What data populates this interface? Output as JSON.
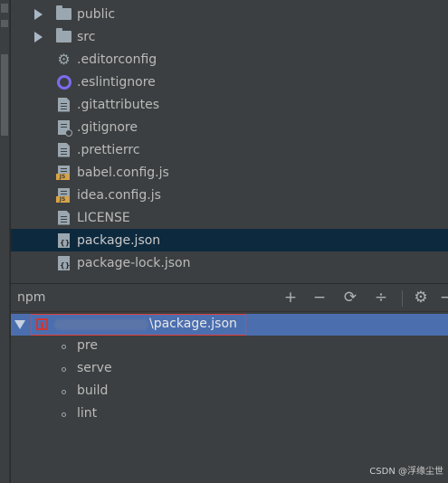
{
  "project_tree": {
    "items": [
      {
        "label": "public",
        "kind": "folder",
        "icon": "folder-icon",
        "expandable": true
      },
      {
        "label": "src",
        "kind": "folder",
        "icon": "folder-icon",
        "expandable": true
      },
      {
        "label": ".editorconfig",
        "kind": "config",
        "icon": "gear-icon"
      },
      {
        "label": ".eslintignore",
        "kind": "eslint",
        "icon": "eslint-icon"
      },
      {
        "label": ".gitattributes",
        "kind": "text",
        "icon": "text-file-icon"
      },
      {
        "label": ".gitignore",
        "kind": "ignore",
        "icon": "ignore-file-icon"
      },
      {
        "label": ".prettierrc",
        "kind": "text",
        "icon": "text-file-icon"
      },
      {
        "label": "babel.config.js",
        "kind": "js",
        "icon": "js-file-icon"
      },
      {
        "label": "idea.config.js",
        "kind": "js",
        "icon": "js-file-icon"
      },
      {
        "label": "LICENSE",
        "kind": "text",
        "icon": "text-file-icon"
      },
      {
        "label": "package.json",
        "kind": "json",
        "icon": "json-file-icon",
        "selected": true
      },
      {
        "label": "package-lock.json",
        "kind": "json",
        "icon": "json-file-icon"
      }
    ]
  },
  "npm_panel": {
    "title": "npm",
    "toolbar": {
      "add_icon": "+",
      "remove_icon": "−",
      "refresh_icon": "⟳",
      "collapse_icon": "÷",
      "settings_icon": "⚙",
      "hide_icon": "−"
    },
    "package_file": {
      "label": "\\package.json",
      "expanded": true
    },
    "scripts": [
      "pre",
      "serve",
      "build",
      "lint"
    ]
  },
  "watermark": "CSDN @浮缘尘世",
  "colors": {
    "panel_bg": "#3c3f41",
    "selection_bg": "#0d293e",
    "active_row_bg": "#4b6eaf",
    "highlight_box": "#e0403f",
    "npm_red": "#cb3837",
    "eslint_purple": "#7a6cf0",
    "js_badge": "#d9a343"
  }
}
